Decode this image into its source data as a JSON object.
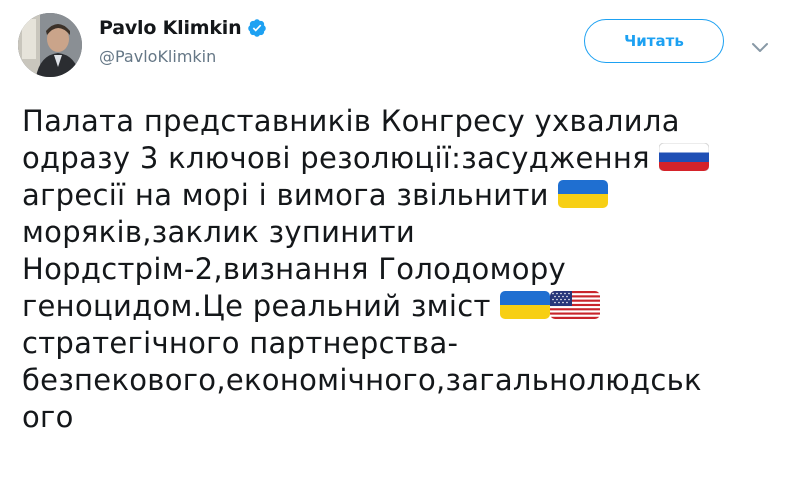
{
  "author": {
    "display_name": "Pavlo Klimkin",
    "handle": "@PavloKlimkin",
    "verified": true,
    "avatar_icon": "user-avatar"
  },
  "follow_button": {
    "label": "Читать"
  },
  "menu": {
    "icon": "chevron-down-icon"
  },
  "tweet": {
    "lines": [
      "Палата представників Конгресу ухвалила",
      "одразу 3 ключові резолюції:засудження",
      "агресії на морі і вимога звільнити",
      "моряків,заклик зупинити",
      "Нордстрім-2,визнання Голодомору",
      "геноцидом.Це реальний зміст",
      "стратегічного партнерства-",
      "безпекового,економічного,загальнолюдськ",
      "ого"
    ],
    "emojis": {
      "russia_flag": "flag-russia-icon",
      "ukraine_flag": "flag-ukraine-icon",
      "usa_flag": "flag-usa-icon"
    }
  },
  "colors": {
    "accent": "#1da1f2",
    "text": "#14171a",
    "secondary_text": "#657786"
  }
}
